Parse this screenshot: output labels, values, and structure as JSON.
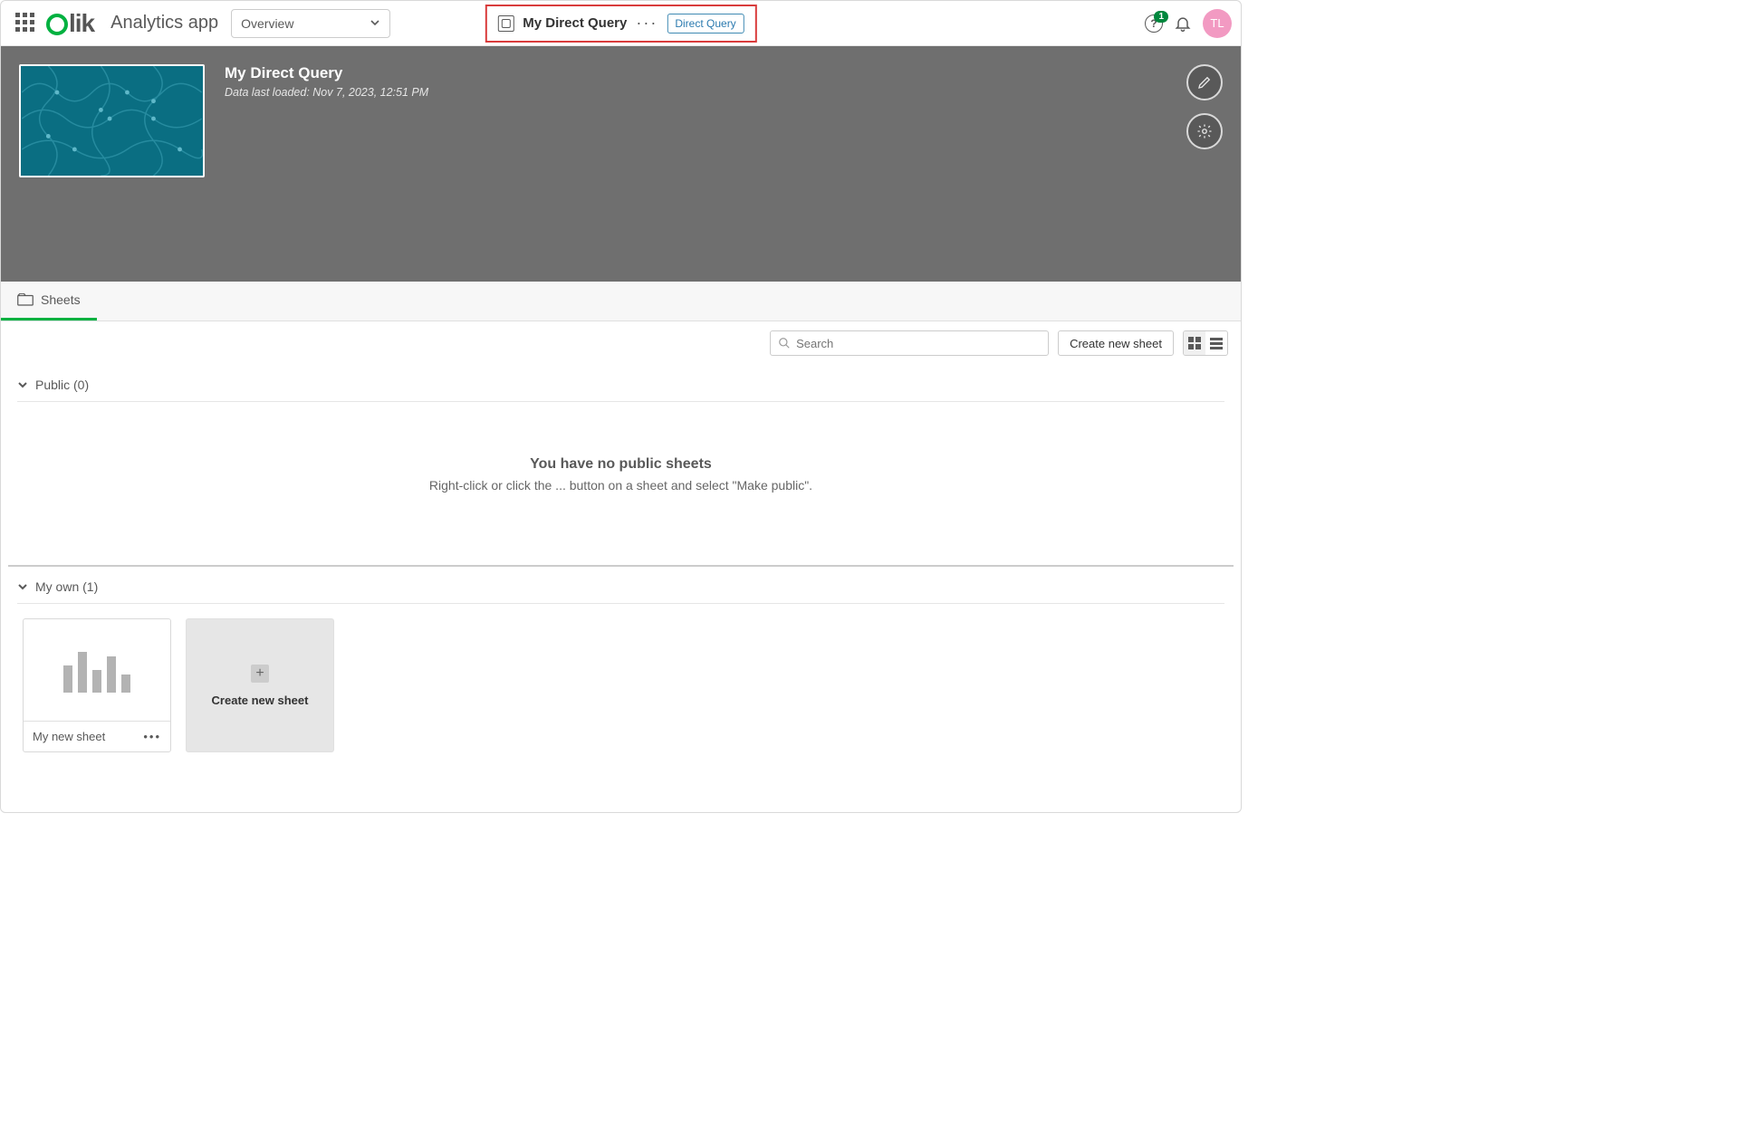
{
  "header": {
    "logo_text": "lik",
    "app_name": "Analytics app",
    "overview_label": "Overview",
    "center": {
      "title": "My Direct Query",
      "badge": "Direct Query"
    },
    "notif_count": "1",
    "avatar_initials": "TL"
  },
  "hero": {
    "title": "My Direct Query",
    "data_loaded": "Data last loaded: Nov 7, 2023, 12:51 PM"
  },
  "tabs": {
    "sheets": "Sheets"
  },
  "toolbar": {
    "search_placeholder": "Search",
    "create_label": "Create new sheet"
  },
  "sections": {
    "public": {
      "heading": "Public (0)",
      "empty_title": "You have no public sheets",
      "empty_sub": "Right-click or click the ... button on a sheet and select \"Make public\"."
    },
    "myown": {
      "heading": "My own (1)",
      "sheet_name": "My new sheet",
      "create_card": "Create new sheet"
    }
  }
}
